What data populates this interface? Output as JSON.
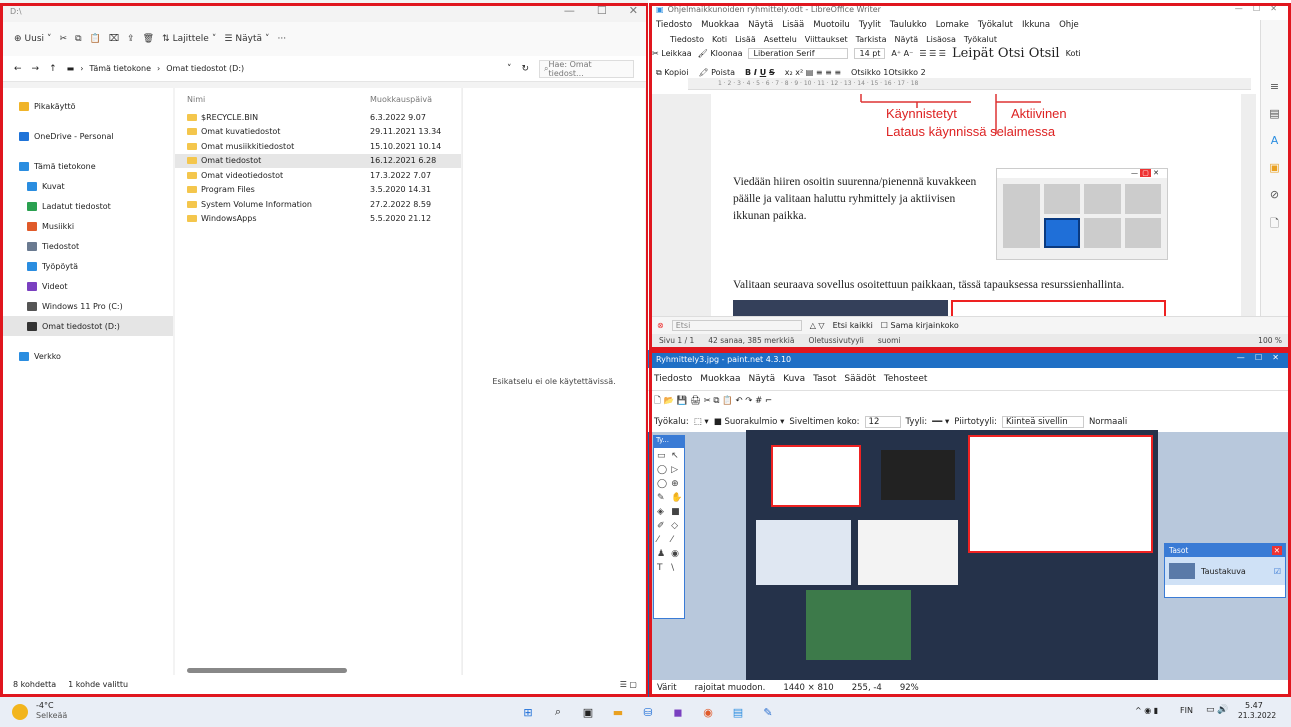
{
  "explorer": {
    "title": "D:\\",
    "cmd": {
      "new": "Uusi",
      "sort": "Lajittele",
      "view": "Näytä",
      "more": "···"
    },
    "path": {
      "pc": "Tämä tietokone",
      "drive": "Omat tiedostot (D:)"
    },
    "search_placeholder": "Hae: Omat tiedost...",
    "nav": [
      {
        "label": "Pikakäyttö",
        "color": "#f0b429"
      },
      {
        "label": "OneDrive - Personal",
        "color": "#1e73d8"
      },
      {
        "label": "Tämä tietokone",
        "color": "#2a8de0"
      },
      {
        "label": "Kuvat",
        "color": "#2a8de0"
      },
      {
        "label": "Ladatut tiedostot",
        "color": "#2aa050"
      },
      {
        "label": "Musiikki",
        "color": "#e05a2a"
      },
      {
        "label": "Tiedostot",
        "color": "#6a7a90"
      },
      {
        "label": "Työpöytä",
        "color": "#2a8de0"
      },
      {
        "label": "Videot",
        "color": "#7a40c0"
      },
      {
        "label": "Windows 11 Pro (C:)",
        "color": "#555"
      },
      {
        "label": "Omat tiedostot (D:)",
        "color": "#333"
      },
      {
        "label": "Verkko",
        "color": "#2a8de0"
      }
    ],
    "col_name": "Nimi",
    "col_modified": "Muokkauspäivä",
    "files": [
      {
        "name": "$RECYCLE.BIN",
        "date": "6.3.2022 9.07"
      },
      {
        "name": "Omat kuvatiedostot",
        "date": "29.11.2021 13.34"
      },
      {
        "name": "Omat musiikkitiedostot",
        "date": "15.10.2021 10.14"
      },
      {
        "name": "Omat tiedostot",
        "date": "16.12.2021 6.28"
      },
      {
        "name": "Omat videotiedostot",
        "date": "17.3.2022 7.07"
      },
      {
        "name": "Program Files",
        "date": "3.5.2020 14.31"
      },
      {
        "name": "System Volume Information",
        "date": "27.2.2022 8.59"
      },
      {
        "name": "WindowsApps",
        "date": "5.5.2020 21.12"
      }
    ],
    "preview": "Esikatselu ei ole käytettävissä.",
    "status_count": "8 kohdetta",
    "status_sel": "1 kohde valittu"
  },
  "writer": {
    "title": "Ohjelmaikkunoiden ryhmittely.odt - LibreOffice Writer",
    "menu": [
      "Tiedosto",
      "Muokkaa",
      "Näytä",
      "Lisää",
      "Muotoilu",
      "Tyylit",
      "Taulukko",
      "Lomake",
      "Työkalut",
      "Ikkuna",
      "Ohje"
    ],
    "tabs": [
      "Tiedosto",
      "Koti",
      "Lisää",
      "Asettelu",
      "Viittaukset",
      "Tarkista",
      "Näytä",
      "Lisäosa",
      "Työkalut"
    ],
    "tool_cut": "Leikkaa",
    "tool_clone": "Kloonaa",
    "tool_font": "Liberation Serif",
    "tool_size": "14 pt",
    "tool_copy": "Kopioi",
    "tool_delete": "Poista",
    "styles": "Leipät  Otsi Otsil",
    "style_sub": "Otsikko 1Otsikko 2",
    "koti": "Koti",
    "annot_started": "Käynnistetyt",
    "annot_active": "Aktiivinen",
    "annot_loading": "Lataus käynnissä selaimessa",
    "para1": "Viedään hiiren osoitin suurenna/pienennä kuvakkeen päälle ja valitaan haluttu ryhmittely ja aktiivisen ikkunan paikka.",
    "para2": "Valitaan seuraava sovellus osoitettuun paikkaan, tässä tapauksessa resurssienhallinta.",
    "find_placeholder": "Etsi",
    "find_all": "Etsi kaikki",
    "match_case": "Sama kirjainkoko",
    "status_page": "Sivu 1 / 1",
    "status_words": "42 sanaa, 385 merkkiä",
    "status_style": "Oletussivutyyli",
    "status_lang": "suomi",
    "zoom": "100 %"
  },
  "paint": {
    "title": "Ryhmittely3.jpg - paint.net 4.3.10",
    "menu": [
      "Tiedosto",
      "Muokkaa",
      "Näytä",
      "Kuva",
      "Tasot",
      "Säädöt",
      "Tehosteet"
    ],
    "tool_label": "Työkalu:",
    "shape": "Suorakulmio",
    "brush_label": "Siveltimen koko:",
    "brush_size": "12",
    "style_label": "Tyyli:",
    "fill_label": "Piirtotyyli:",
    "fill_value": "Kiinteä sivellin",
    "blend": "Normaali",
    "tools_title": "Ty...",
    "layers_title": "Tasot",
    "layer_name": "Taustakuva",
    "status_hint": "rajoitat muodon.",
    "status_size": "1440 × 810",
    "status_pos": "255, -4",
    "status_zoom": "92%",
    "colors_label": "Värit",
    "px": "px"
  },
  "taskbar": {
    "temp": "-4°C",
    "weather": "Selkeää",
    "lang": "FIN",
    "time": "5.47",
    "date": "21.3.2022"
  }
}
